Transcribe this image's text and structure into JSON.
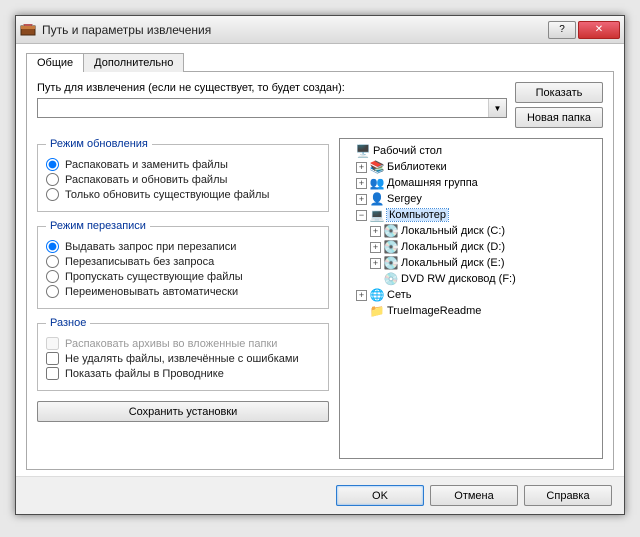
{
  "window": {
    "title": "Путь и параметры извлечения"
  },
  "tabs": {
    "general": "Общие",
    "advanced": "Дополнительно"
  },
  "path": {
    "label": "Путь для извлечения (если не существует, то будет создан):",
    "value": ""
  },
  "buttons": {
    "show": "Показать",
    "new_folder": "Новая папка",
    "save_settings": "Сохранить установки",
    "ok": "OK",
    "cancel": "Отмена",
    "help": "Справка"
  },
  "groups": {
    "update_mode": {
      "legend": "Режим обновления",
      "r1": "Распаковать и заменить файлы",
      "r2": "Распаковать и обновить файлы",
      "r3": "Только обновить существующие файлы"
    },
    "overwrite_mode": {
      "legend": "Режим перезаписи",
      "r1": "Выдавать запрос при перезаписи",
      "r2": "Перезаписывать без запроса",
      "r3": "Пропускать существующие файлы",
      "r4": "Переименовывать автоматически"
    },
    "misc": {
      "legend": "Разное",
      "c1": "Распаковать архивы во вложенные папки",
      "c2": "Не удалять файлы, извлечённые с ошибками",
      "c3": "Показать файлы в Проводнике"
    }
  },
  "tree": {
    "desktop": "Рабочий стол",
    "libraries": "Библиотеки",
    "homegroup": "Домашняя группа",
    "user": "Sergey",
    "computer": "Компьютер",
    "disk_c": "Локальный диск (C:)",
    "disk_d": "Локальный диск (D:)",
    "disk_e": "Локальный диск (E:)",
    "dvd": "DVD RW дисковод (F:)",
    "network": "Сеть",
    "readme": "TrueImageReadme"
  }
}
